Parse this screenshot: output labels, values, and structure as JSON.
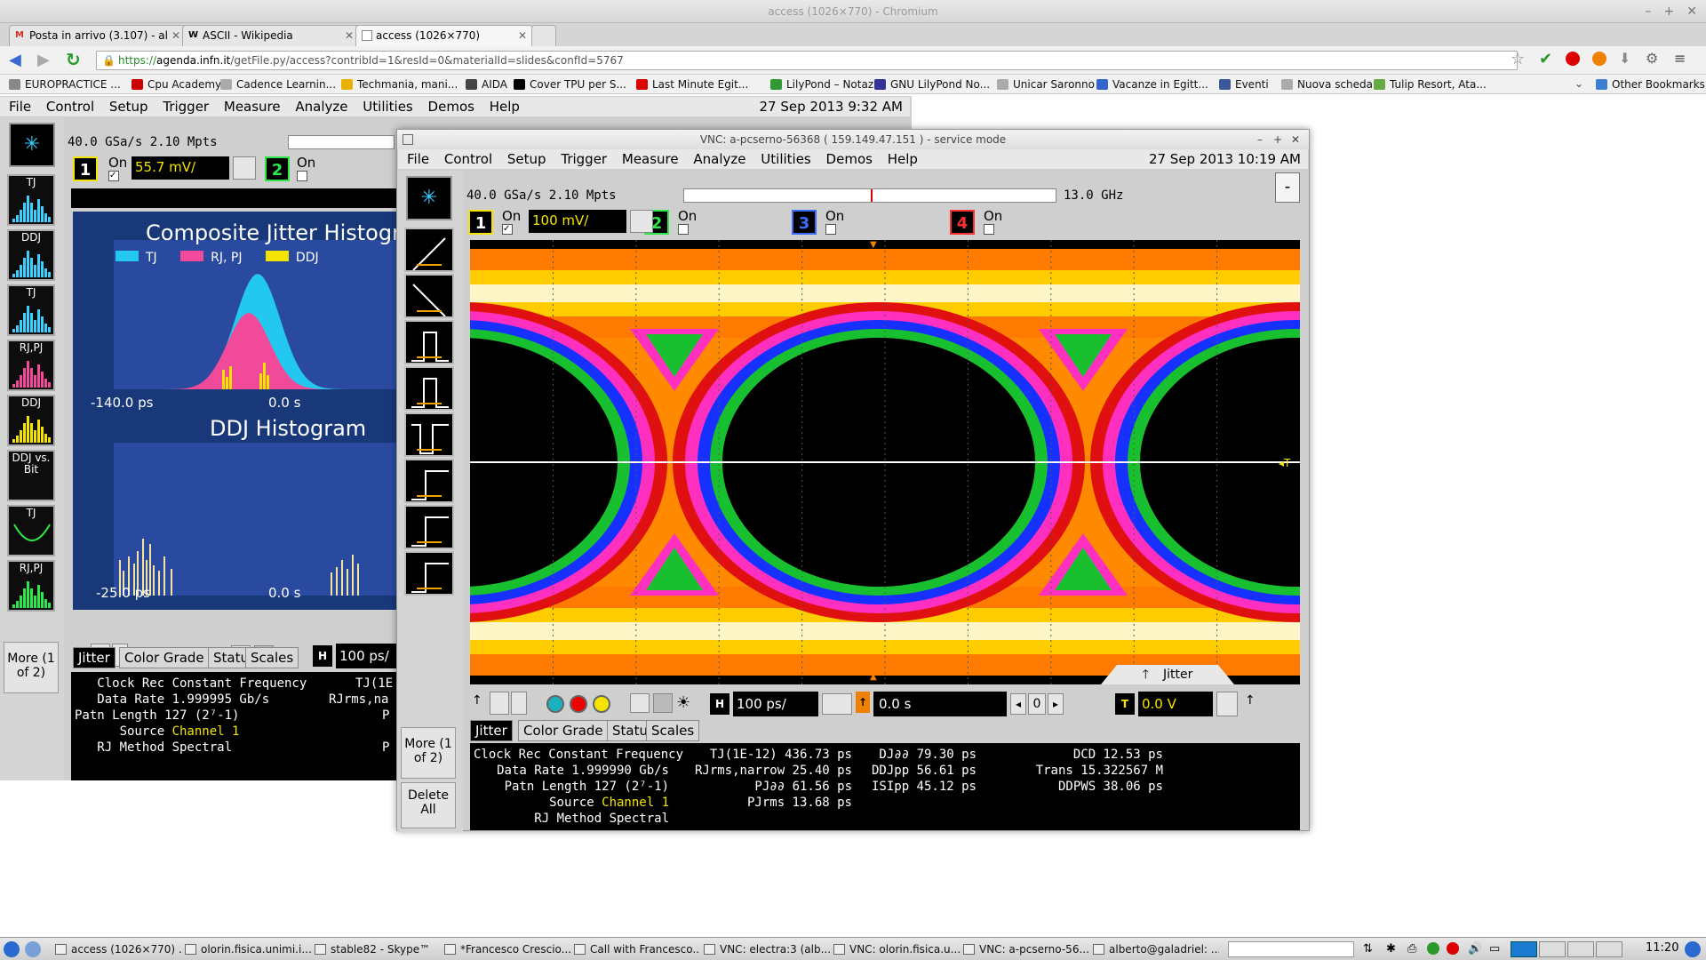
{
  "window": {
    "title": "access (1026×770) - Chromium"
  },
  "tabs": [
    {
      "label": "Posta in arrivo (3.107) - al",
      "icon": "gmail-icon",
      "glyph": "M",
      "color": "#d93025"
    },
    {
      "label": "ASCII - Wikipedia",
      "icon": "wikipedia-icon",
      "glyph": "W",
      "color": "#222"
    },
    {
      "label": "access (1026×770)",
      "icon": "page-icon",
      "glyph": "",
      "color": "#555"
    }
  ],
  "address": {
    "url_prefix": "https://",
    "host": "agenda.infn.it",
    "path": "/getFile.py/access?contribId=1&resId=0&materialId=slides&confId=5767"
  },
  "bookmarks": [
    {
      "label": "EUROPRACTICE ...",
      "color": "#888"
    },
    {
      "label": "Cpu Academy",
      "color": "#c00"
    },
    {
      "label": "Cadence Learnin...",
      "color": "#aaa"
    },
    {
      "label": "Techmania, mani...",
      "color": "#e8b000"
    },
    {
      "label": "AIDA",
      "color": "#444"
    },
    {
      "label": "Cover TPU per S...",
      "color": "#000"
    },
    {
      "label": "Last Minute Egit...",
      "color": "#d00"
    },
    {
      "label": "LilyPond – Notaz...",
      "color": "#393"
    },
    {
      "label": "GNU LilyPond No...",
      "color": "#339"
    },
    {
      "label": "Unicar Saronno",
      "color": "#aaa"
    },
    {
      "label": "Vacanze in Egitt...",
      "color": "#36c"
    },
    {
      "label": "Eventi",
      "color": "#3b5998"
    },
    {
      "label": "Nuova scheda",
      "color": "#aaa"
    },
    {
      "label": "Tulip Resort, Ata...",
      "color": "#6a4"
    }
  ],
  "other_bookmarks": "Other Bookmarks",
  "scope1": {
    "menu": [
      "File",
      "Control",
      "Setup",
      "Trigger",
      "Measure",
      "Analyze",
      "Utilities",
      "Demos",
      "Help"
    ],
    "datetime": "27 Sep 2013  9:32 AM",
    "acq": "40.0 GSa/s   2.10 Mpts",
    "ch1_on": "On",
    "ch1_scale": "55.7 mV/",
    "ch2_on": "On",
    "composite_title": "Composite Jitter Histogra",
    "legend": [
      "TJ",
      "RJ, PJ",
      "DDJ"
    ],
    "legend_colors": [
      "#22c8f0",
      "#f24a9a",
      "#f5e400"
    ],
    "axis1_left": "-140.0 ps",
    "axis1_mid": "0.0 s",
    "ddj_title": "DDJ Histogram",
    "axis2_left": "-25.0 ps",
    "axis2_mid": "0.0 s",
    "side_buttons": [
      "TJ",
      "DDJ",
      "TJ",
      "RJ,PJ",
      "DDJ",
      "DDJ vs. Bit",
      "TJ",
      "RJ,PJ"
    ],
    "more": "More (1 of 2)",
    "timebase": "100 ps/",
    "tabs": [
      "Jitter",
      "Color Grade",
      "Status",
      "Scales"
    ],
    "info": [
      "   Clock Rec Constant Frequency",
      "   Data Rate 1.999995 Gb/s",
      "Patn Length 127 (2⁷-1)",
      "      Source ",
      "   RJ Method Spectral"
    ],
    "source_value": "Channel 1",
    "tj_cut": "TJ(1E",
    "rj_cut": "RJrms,na",
    "p1": "P",
    "p2": "P"
  },
  "vnc": {
    "title": "VNC: a-pcserno-56368 ( 159.149.47.151 ) - service mode",
    "menu": [
      "File",
      "Control",
      "Setup",
      "Trigger",
      "Measure",
      "Analyze",
      "Utilities",
      "Demos",
      "Help"
    ],
    "datetime": "27 Sep 2013 10:19 AM",
    "acq": "40.0 GSa/s   2.10 Mpts",
    "bandwidth": "13.0 GHz",
    "channels": [
      {
        "num": "1",
        "on": "On",
        "color": "#f5e400"
      },
      {
        "num": "2",
        "on": "On",
        "color": "#2ee84a"
      },
      {
        "num": "3",
        "on": "On",
        "color": "#3a6cff"
      },
      {
        "num": "4",
        "on": "On",
        "color": "#ff3030"
      }
    ],
    "ch1_scale": "100 mV/",
    "more": "More (1 of 2)",
    "delete": "Delete All",
    "timebase": "100 ps/",
    "delay": "0.0 s",
    "zero": "0",
    "trig_level": "0.0 V",
    "jitter_label": "Jitter",
    "tabs": [
      "Jitter",
      "Color Grade",
      "Status",
      "Scales"
    ],
    "col1": [
      "Clock Rec Constant Frequency",
      "Data Rate 1.999990 Gb/s",
      "Patn Length 127 (2⁷-1)",
      "Source ",
      "RJ Method Spectral"
    ],
    "source_value": "Channel 1",
    "col2": [
      "TJ(1E-12) 436.73 ps",
      "RJrms,narrow 25.40 ps",
      "PJ∂∂ 61.56 ps",
      "PJrms 13.68 ps"
    ],
    "col3": [
      "DJ∂∂ 79.30 ps",
      "DDJpp 56.61 ps",
      "ISIpp 45.12 ps"
    ],
    "col4": [
      "DCD 12.53 ps",
      "Trans 15.322567 M",
      "DDPWS 38.06 ps"
    ]
  },
  "taskbar": {
    "items": [
      "access (1026×770) ...",
      "olorin.fisica.unimi.i...",
      "stable82 - Skype™",
      "*Francesco Crescio...",
      "Call with Francesco...",
      "VNC: electra:3 (alb...",
      "VNC: olorin.fisica.u...",
      "VNC: a-pcserno-56...",
      "alberto@galadriel: ..."
    ],
    "clock": "11:20"
  }
}
